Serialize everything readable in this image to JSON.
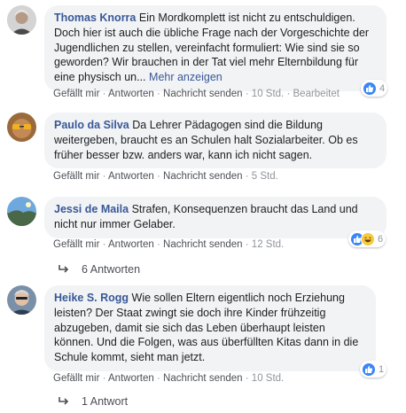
{
  "comments": [
    {
      "author": "Thomas Knorra",
      "text": "Ein Mordkomplett ist nicht zu entschuldigen. Doch hier ist auch die übliche Frage nach der Vorgeschichte der Jugendlichen zu stellen, vereinfacht formuliert: Wie sind sie so geworden? Wir brauchen in der Tat viel mehr Elternbildung für eine physisch un...",
      "more": "Mehr anzeigen",
      "like": "Gefällt mir",
      "reply": "Antworten",
      "message": "Nachricht senden",
      "time": "10 Std.",
      "edited": "Bearbeitet",
      "reaction_count": "4",
      "reactions": [
        "like-icon"
      ]
    },
    {
      "author": "Paulo da Silva",
      "text": "Da Lehrer Pädagogen sind die Bildung weitergeben, braucht es an Schulen halt Sozialarbeiter. Ob es früher besser bzw. anders war, kann ich nicht sagen.",
      "like": "Gefällt mir",
      "reply": "Antworten",
      "message": "Nachricht senden",
      "time": "5 Std."
    },
    {
      "author": "Jessi de Maila",
      "text": "Strafen, Konsequenzen braucht das Land und nicht nur immer Gelaber.",
      "like": "Gefällt mir",
      "reply": "Antworten",
      "message": "Nachricht senden",
      "time": "12 Std.",
      "reaction_count": "6",
      "reactions": [
        "like-icon",
        "haha-icon"
      ],
      "replies": "6 Antworten"
    },
    {
      "author": "Heike S. Rogg",
      "text": "Wie sollen Eltern eigentlich noch Erziehung leisten? Der Staat zwingt sie doch ihre Kinder frühzeitig abzugeben, damit sie sich das Leben überhaupt leisten können. Und die Folgen, was aus überfüllten Kitas dann in die Schule kommt, sieht man jetzt.",
      "like": "Gefällt mir",
      "reply": "Antworten",
      "message": "Nachricht senden",
      "time": "10 Std.",
      "reaction_count": "1",
      "reactions": [
        "like-icon"
      ],
      "replies": "1 Antwort"
    }
  ],
  "separator": "·",
  "colors": {
    "link": "#385898",
    "bubble": "#f2f3f5",
    "meta": "#90949c",
    "like_blue": "#3b86f7"
  }
}
